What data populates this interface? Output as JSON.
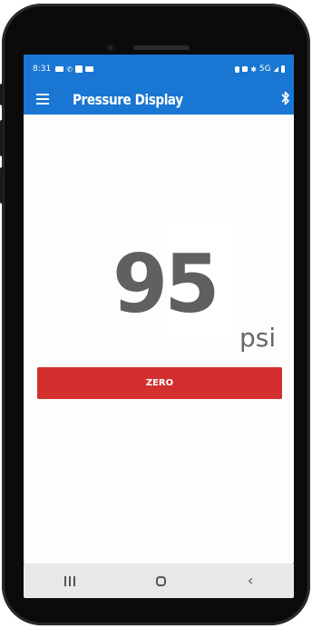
{
  "status_bar": {
    "time": "8:31",
    "network": "5G"
  },
  "app_bar": {
    "title": "Pressure Display",
    "menu_icon": "hamburger-menu-icon",
    "bluetooth_icon": "bluetooth-icon"
  },
  "reading": {
    "value": "95",
    "unit": "psi"
  },
  "zero_button": {
    "label": "ZERO"
  },
  "nav_bar": {
    "recent_icon": "recent-apps-icon",
    "home_icon": "home-icon",
    "back_icon": "back-icon"
  },
  "colors": {
    "primary": "#1976d2",
    "accent_red": "#d32f2f",
    "value_gray": "#606060"
  }
}
